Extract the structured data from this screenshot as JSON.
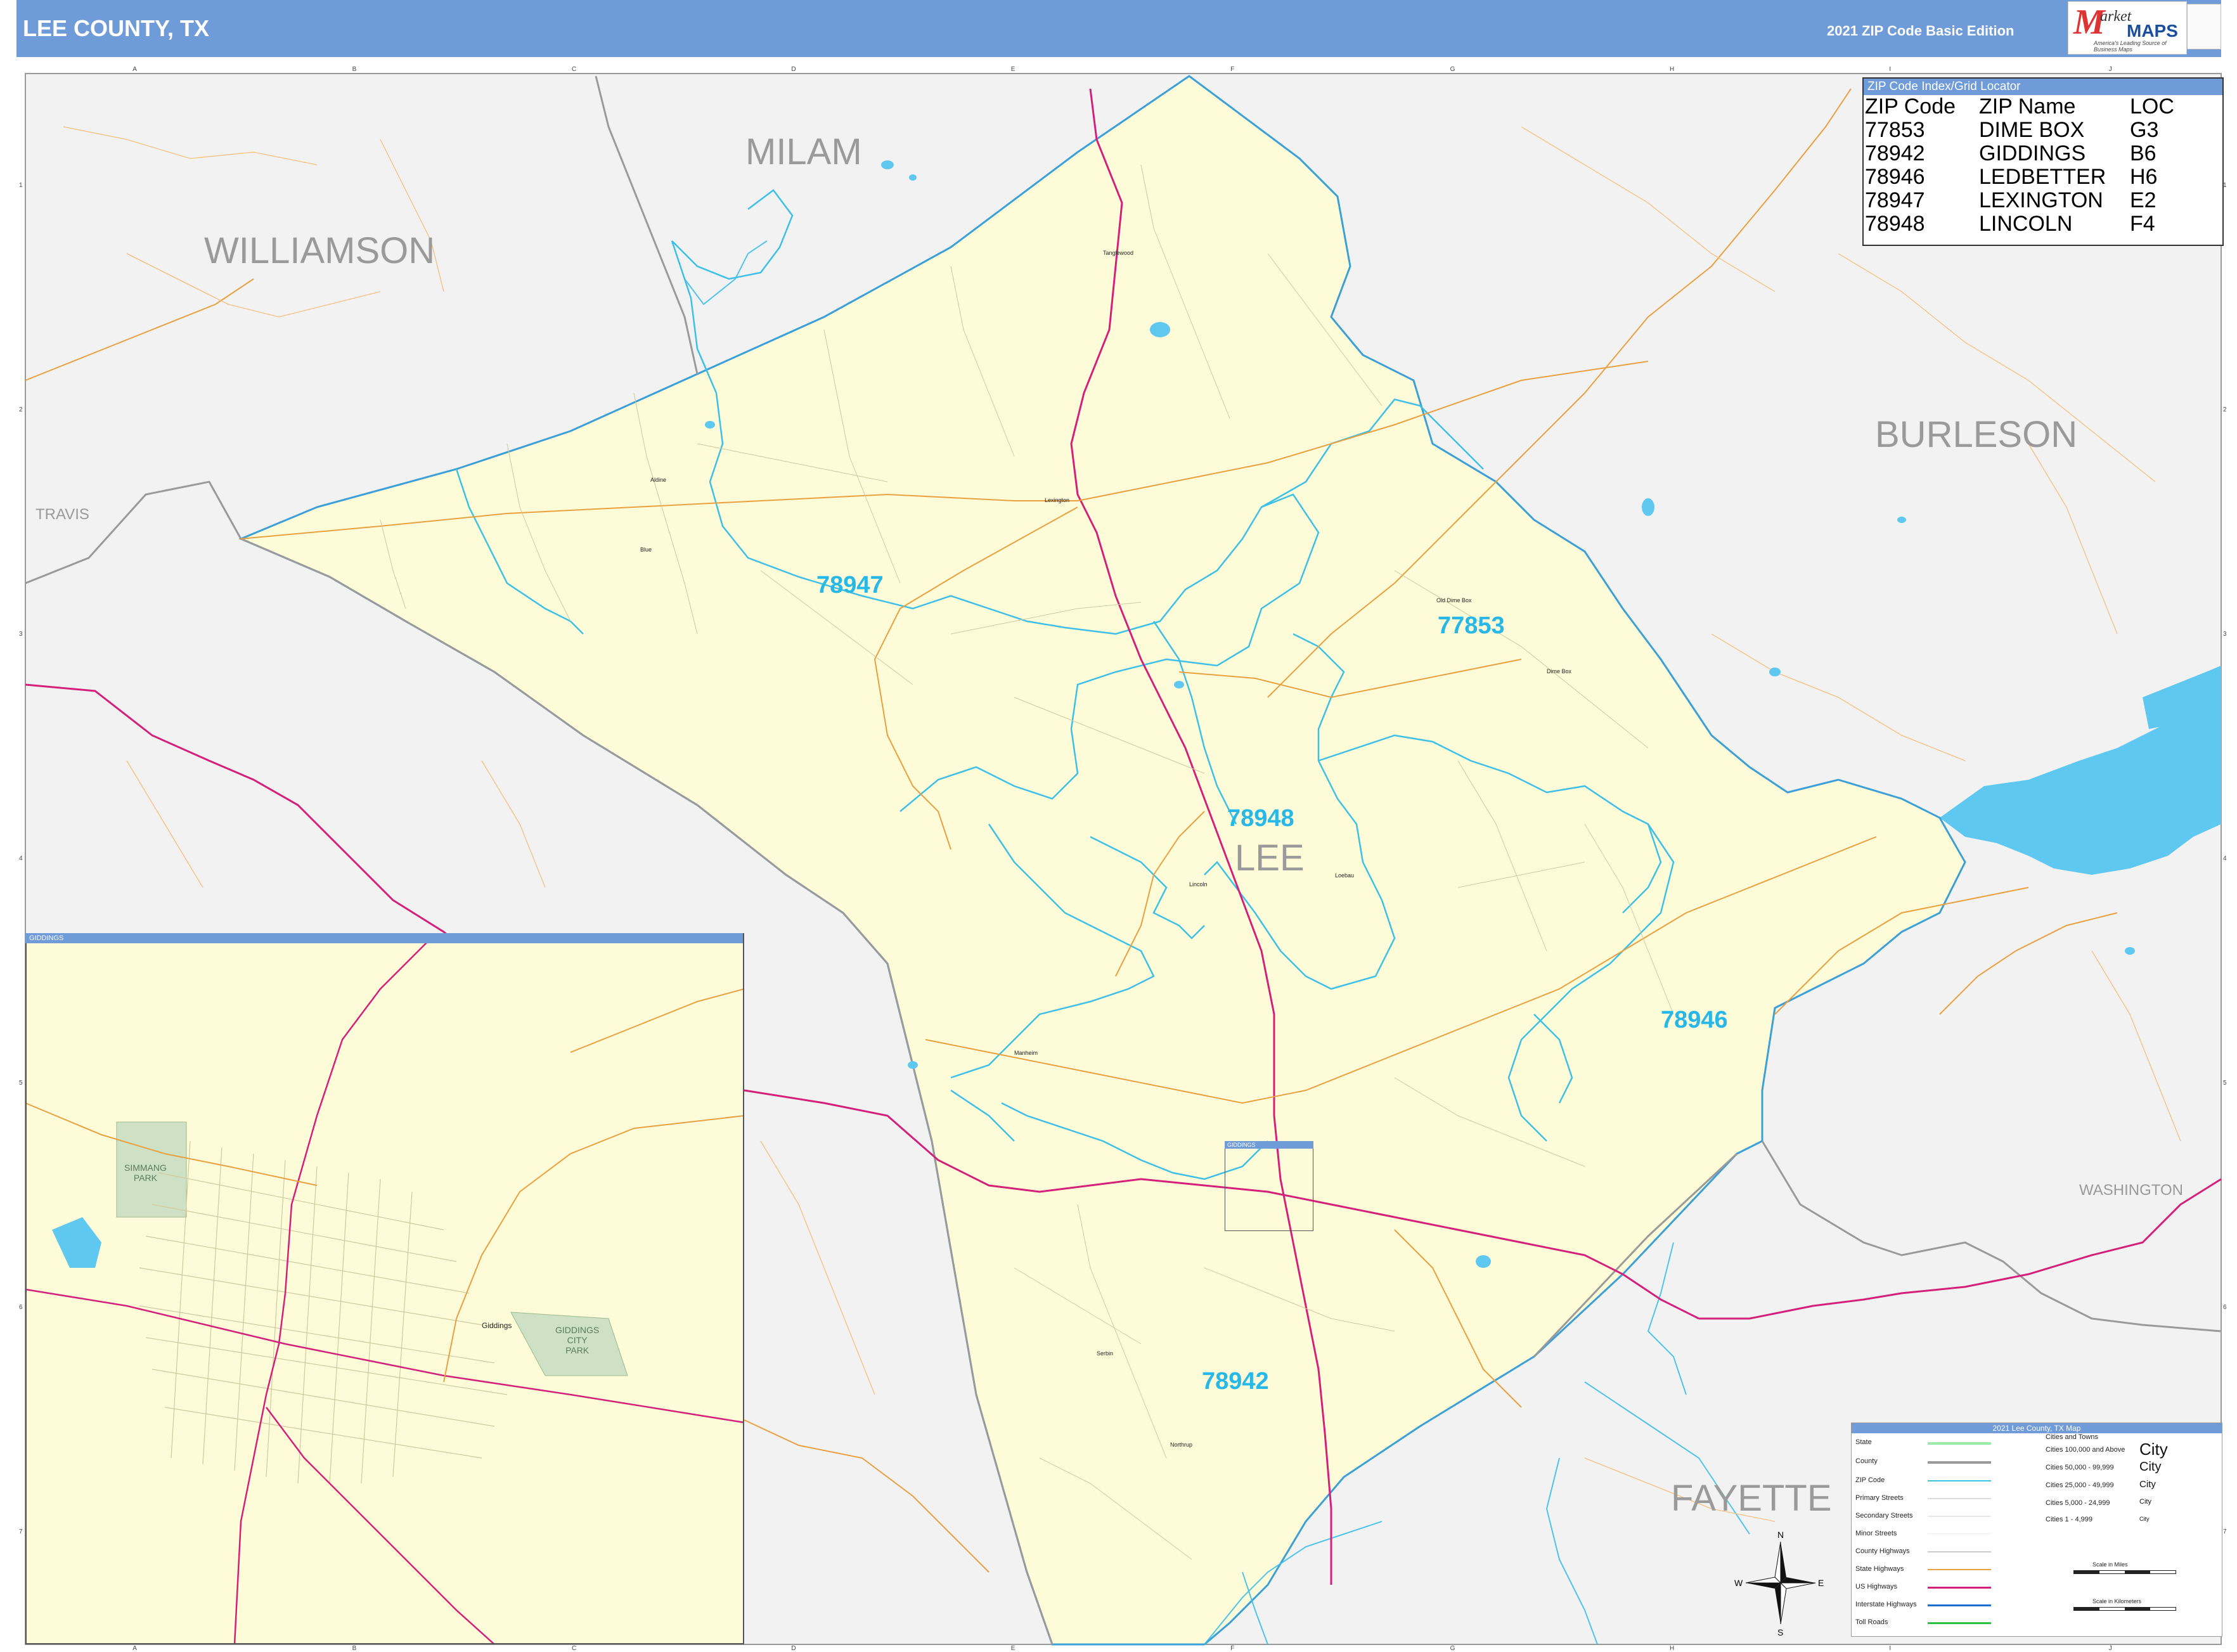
{
  "header": {
    "title": "LEE COUNTY, TX",
    "edition": "2021 ZIP Code Basic Edition"
  },
  "logo": {
    "m": "M",
    "arket": "arket",
    "maps": "MAPS",
    "tagline": "America's Leading Source of Business Maps"
  },
  "grid": {
    "columns": [
      "A",
      "B",
      "C",
      "D",
      "E",
      "F",
      "G",
      "H",
      "I",
      "J"
    ],
    "rows": [
      "1",
      "2",
      "3",
      "4",
      "5",
      "6",
      "7"
    ]
  },
  "counties": {
    "milam": "MILAM",
    "williamson": "WILLIAMSON",
    "burleson": "BURLESON",
    "travis": "TRAVIS",
    "lee": "LEE",
    "washington": "WASHINGTON",
    "fayette": "FAYETTE"
  },
  "zip_labels": {
    "z78947": "78947",
    "z77853": "77853",
    "z78948": "78948",
    "z78946": "78946",
    "z78942": "78942"
  },
  "cities": {
    "tanglewood": "Tanglewood",
    "lexington": "Lexington",
    "aldine": "Aldine",
    "blue": "Blue",
    "dime_box": "Dime Box",
    "old_dime_box": "Old Dime Box",
    "lincoln": "Lincoln",
    "loebau": "Loebau",
    "manheim": "Manheim",
    "giddings": "Giddings",
    "serbin": "Serbin",
    "northrup": "Northrup"
  },
  "zip_index": {
    "title": "ZIP Code Index/Grid Locator",
    "headers": [
      "ZIP Code",
      "ZIP Name",
      "LOC"
    ],
    "rows": [
      [
        "77853",
        "DIME BOX",
        "G3"
      ],
      [
        "78942",
        "GIDDINGS",
        "B6"
      ],
      [
        "78946",
        "LEDBETTER",
        "H6"
      ],
      [
        "78947",
        "LEXINGTON",
        "E2"
      ],
      [
        "78948",
        "LINCOLN",
        "F4"
      ]
    ]
  },
  "inset": {
    "title": "GIDDINGS",
    "city": "Giddings",
    "park1_line1": "SIMMANG",
    "park1_line2": "PARK",
    "park2_line1": "GIDDINGS",
    "park2_line2": "CITY",
    "park2_line3": "PARK"
  },
  "giddings_box": "GIDDINGS",
  "legend": {
    "title": "2021 Lee County, TX Map",
    "items": [
      "State",
      "County",
      "ZIP Code",
      "Primary Streets",
      "Secondary Streets",
      "Minor Streets",
      "County Highways",
      "State Highways",
      "US Highways",
      "Interstate Highways",
      "Toll Roads"
    ],
    "cities_title": "Cities and Towns",
    "city_sizes": [
      "Cities 100,000 and Above",
      "Cities 50,000 - 99,999",
      "Cities 25,000 - 49,999",
      "Cities 5,000 - 24,999",
      "Cities 1 - 4,999"
    ],
    "city_sample": "City",
    "scale_miles": "Scale in Miles",
    "scale_km": "Scale in Kilometers"
  },
  "compass": {
    "n": "N",
    "s": "S",
    "e": "E",
    "w": "W"
  },
  "colors": {
    "header": "#6f9bd8",
    "lee_fill": "#fefbd8",
    "outside_fill": "#f2f2f2",
    "zip_boundary": "#3cc0e8",
    "county_line": "#9a9a9a",
    "us_highway": "#d4207a",
    "state_highway": "#e8a040",
    "water": "#5ec8f0"
  }
}
